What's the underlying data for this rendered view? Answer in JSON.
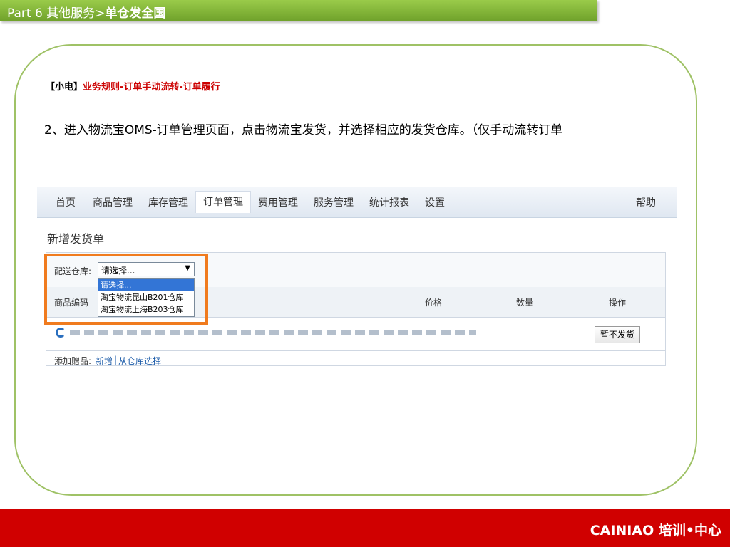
{
  "header": {
    "part": "Part  6   其他服务>",
    "topic": "单仓发全国"
  },
  "rule": {
    "tag": "【小电】",
    "text": "业务规则-订单手动流转-订单履行"
  },
  "instruction": "2、进入物流宝OMS-订单管理页面，点击物流宝发货，并选择相应的发货仓库。（仅手动流转订单",
  "screenshot": {
    "nav": [
      "首页",
      "商品管理",
      "库存管理",
      "订单管理",
      "费用管理",
      "服务管理",
      "统计报表",
      "设置"
    ],
    "nav_active": "订单管理",
    "nav_help": "帮助",
    "panel_title": "新增发货单",
    "warehouse_label": "配送仓库:",
    "warehouse_selected": "请选择...",
    "warehouse_options": [
      "请选择...",
      "淘宝物流昆山B201仓库",
      "淘宝物流上海B203仓库"
    ],
    "table_headers": {
      "code": "商品编码",
      "price": "价格",
      "qty": "数量",
      "action": "操作"
    },
    "row_button": "暂不发货",
    "add_label": "添加赠品:",
    "add_new": "新增",
    "add_sep": "|",
    "add_from": "从仓库选择"
  },
  "footer": {
    "brand": "CAINIAO  培训•中心"
  },
  "colors": {
    "header_green": "#7cb342",
    "frame_green": "#9fc266",
    "rule_red": "#cc0000",
    "highlight_orange": "#f07b1e",
    "footer_red": "#d00000"
  }
}
